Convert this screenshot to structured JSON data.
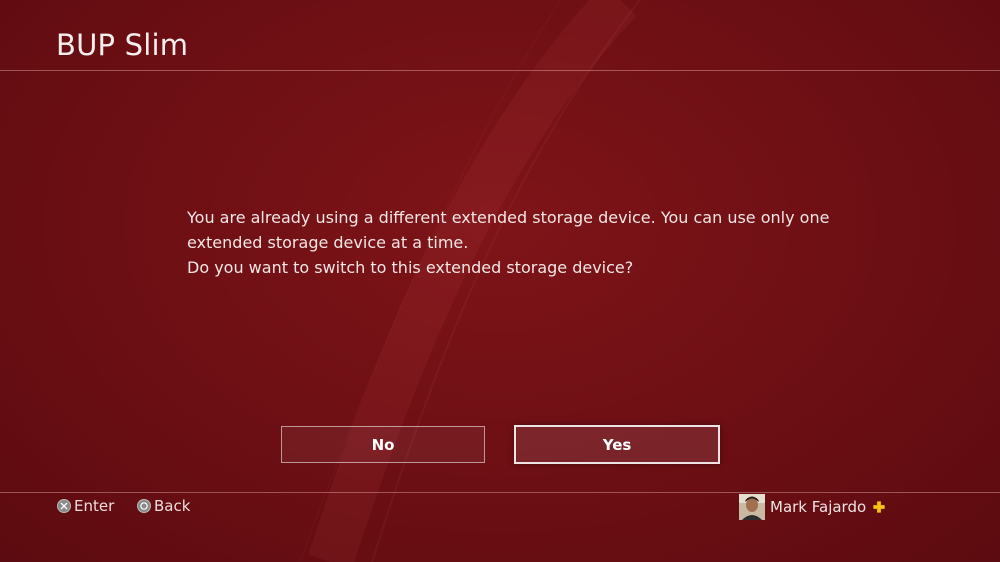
{
  "header": {
    "title": "BUP Slim"
  },
  "dialog": {
    "message_lines": [
      "You are already using a different extended storage device. You can use only one",
      "extended storage device at a time.",
      "Do you want to switch to this extended storage device?"
    ],
    "buttons": {
      "no_label": "No",
      "yes_label": "Yes",
      "focused": "Yes"
    }
  },
  "footer": {
    "hints": [
      {
        "icon": "cross-button-icon",
        "label": "Enter"
      },
      {
        "icon": "circle-button-icon",
        "label": "Back"
      }
    ],
    "user": {
      "name": "Mark Fajardo",
      "avatar_icon": "user-avatar",
      "plus_icon": "playstation-plus-icon"
    }
  },
  "colors": {
    "background": "#6c0f14",
    "text": "#ffffff",
    "plus": "#f5c518"
  }
}
